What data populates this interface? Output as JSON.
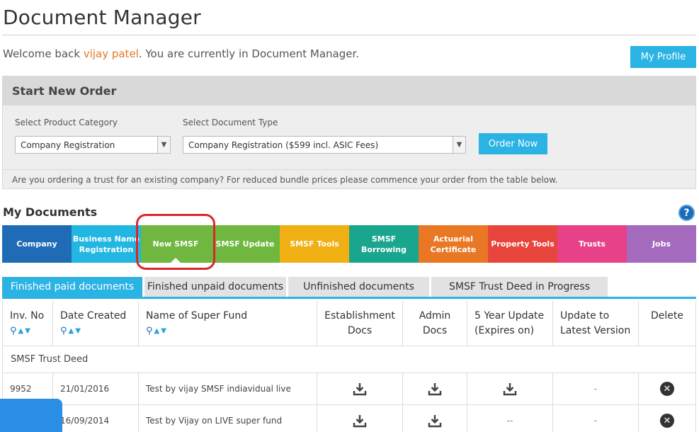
{
  "header": {
    "title": "Document Manager"
  },
  "welcome": {
    "prefix": "Welcome back ",
    "user": "vijay patel",
    "suffix": ". You are currently in Document Manager."
  },
  "profile_button": "My Profile",
  "order": {
    "heading": "Start New Order",
    "category_label": "Select Product Category",
    "category_value": "Company Registration",
    "doctype_label": "Select Document Type",
    "doctype_value": "Company Registration ($599 incl. ASIC Fees)",
    "order_button": "Order Now",
    "note": "Are you ordering a trust for an existing company? For reduced bundle prices please commence your order from the table below."
  },
  "docs": {
    "title": "My Documents",
    "help": "?"
  },
  "categories": [
    {
      "label": "Company",
      "color": "#1f6bb5"
    },
    {
      "label": "Business Name Registration",
      "color": "#22b6e2"
    },
    {
      "label": "New SMSF",
      "color": "#6fb73e"
    },
    {
      "label": "SMSF Update",
      "color": "#6fb73e"
    },
    {
      "label": "SMSF Tools",
      "color": "#f0b013"
    },
    {
      "label": "SMSF Borrowing",
      "color": "#1aa58f"
    },
    {
      "label": "Actuarial Certificate",
      "color": "#ea7724"
    },
    {
      "label": "Property Tools",
      "color": "#e8463d"
    },
    {
      "label": "Trusts",
      "color": "#e64189"
    },
    {
      "label": "Jobs",
      "color": "#a46abd"
    }
  ],
  "tabs": [
    {
      "label": "Finished paid documents"
    },
    {
      "label": "Finished unpaid documents"
    },
    {
      "label": "Unfinished documents"
    },
    {
      "label": "SMSF Trust Deed in Progress"
    }
  ],
  "table": {
    "headers": {
      "inv": "Inv. No",
      "date": "Date Created",
      "name": "Name of Super Fund",
      "estab_1": "Establishment",
      "estab_2": "Docs",
      "admin_1": "Admin",
      "admin_2": "Docs",
      "five_1": "5 Year Update",
      "five_2": "(Expires on)",
      "upd_1": "Update to",
      "upd_2": "Latest Version",
      "del": "Delete"
    },
    "section": "SMSF Trust Deed",
    "rows": [
      {
        "inv": "9952",
        "date": "21/01/2016",
        "name": "Test by vijay SMSF indiavidual live",
        "update": "-"
      },
      {
        "inv": "",
        "date": "16/09/2014",
        "name": "Test by Vijay on LIVE super fund",
        "five": "--",
        "update": "-"
      }
    ]
  }
}
